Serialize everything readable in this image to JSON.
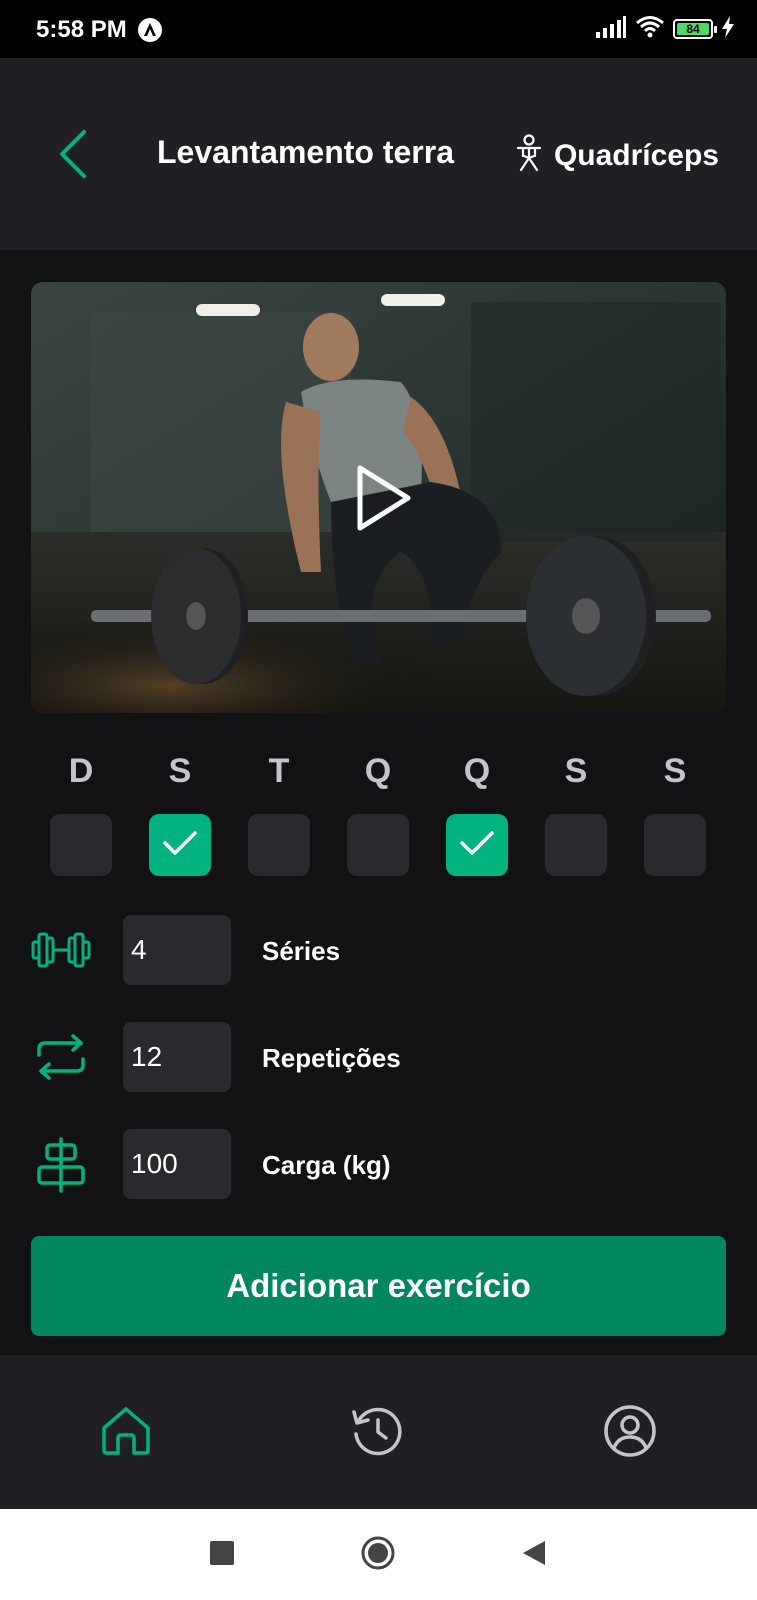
{
  "status_bar": {
    "time": "5:58 PM",
    "battery": "84",
    "icons": [
      "signal-icon",
      "wifi-icon",
      "battery-icon",
      "charging-icon"
    ]
  },
  "header": {
    "back_icon": "chevron-left-icon",
    "title": "Levantamento terra",
    "muscle_icon": "body-icon",
    "muscle": "Quadríceps"
  },
  "video": {
    "play_icon": "play-icon"
  },
  "days": [
    {
      "label": "D",
      "checked": false
    },
    {
      "label": "S",
      "checked": true
    },
    {
      "label": "T",
      "checked": false
    },
    {
      "label": "Q",
      "checked": false
    },
    {
      "label": "Q",
      "checked": true
    },
    {
      "label": "S",
      "checked": false
    },
    {
      "label": "S",
      "checked": false
    }
  ],
  "fields": {
    "series": {
      "value": "4",
      "label": "Séries",
      "icon": "dumbbell-icon"
    },
    "reps": {
      "value": "12",
      "label": "Repetições",
      "icon": "repeat-icon"
    },
    "load": {
      "value": "100",
      "label": "Carga (kg)",
      "icon": "load-icon"
    }
  },
  "add_button": {
    "label": "Adicionar exercício"
  },
  "bottom_nav": [
    {
      "name": "home",
      "icon": "home-icon",
      "active": true
    },
    {
      "name": "history",
      "icon": "history-icon",
      "active": false
    },
    {
      "name": "profile",
      "icon": "profile-icon",
      "active": false
    }
  ],
  "colors": {
    "accent": "#00b37e",
    "button": "#00875f",
    "background": "#121214",
    "surface": "#202024",
    "input": "#29292e"
  }
}
